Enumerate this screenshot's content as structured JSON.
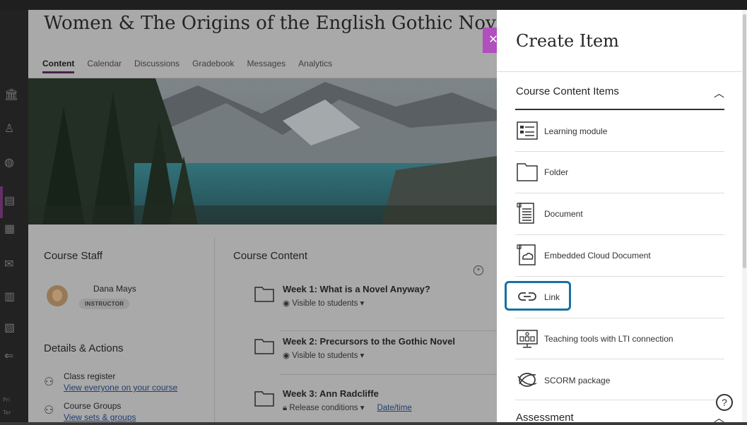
{
  "course": {
    "title": "Women & The Origins of the English Gothic Novel",
    "tabs": [
      {
        "label": "Content"
      },
      {
        "label": "Calendar"
      },
      {
        "label": "Discussions"
      },
      {
        "label": "Gradebook"
      },
      {
        "label": "Messages"
      },
      {
        "label": "Analytics"
      }
    ],
    "staff_title": "Course Staff",
    "staff_name": "Dana Mays",
    "staff_role": "INSTRUCTOR",
    "details_title": "Details & Actions",
    "details": [
      {
        "label": "Class register",
        "link": "View everyone on your course",
        "icon": "people-icon"
      },
      {
        "label": "Course Groups",
        "link": "View sets & groups",
        "icon": "groups-icon"
      }
    ],
    "content_title": "Course Content",
    "items": [
      {
        "title": "Week 1: What is a Novel Anyway?",
        "status": "Visible to students",
        "icon": "eye-icon"
      },
      {
        "title": "Week 2: Precursors to the Gothic Novel",
        "status": "Visible to students",
        "icon": "eye-icon"
      },
      {
        "title": "Week 3: Ann Radcliffe",
        "status": "Release conditions",
        "extra_link": "Date/time",
        "icon": "lock-icon"
      }
    ]
  },
  "panel": {
    "title": "Create Item",
    "section": "Course Content Items",
    "items": [
      {
        "label": "Learning module",
        "icon": "learning-module-icon"
      },
      {
        "label": "Folder",
        "icon": "folder-icon"
      },
      {
        "label": "Document",
        "icon": "document-icon"
      },
      {
        "label": "Embedded Cloud Document",
        "icon": "cloud-document-icon"
      },
      {
        "label": "Link",
        "icon": "link-icon"
      },
      {
        "label": "Teaching tools with LTI connection",
        "icon": "lti-tools-icon"
      },
      {
        "label": "SCORM package",
        "icon": "scorm-icon"
      }
    ],
    "next_section": "Assessment",
    "help": "?"
  },
  "leftnav": {
    "footer": [
      "Pri",
      "Ter"
    ]
  },
  "colors": {
    "accent": "#b04fbd",
    "focus": "#1b6fa3",
    "active_tab": "#5a2a5a"
  }
}
